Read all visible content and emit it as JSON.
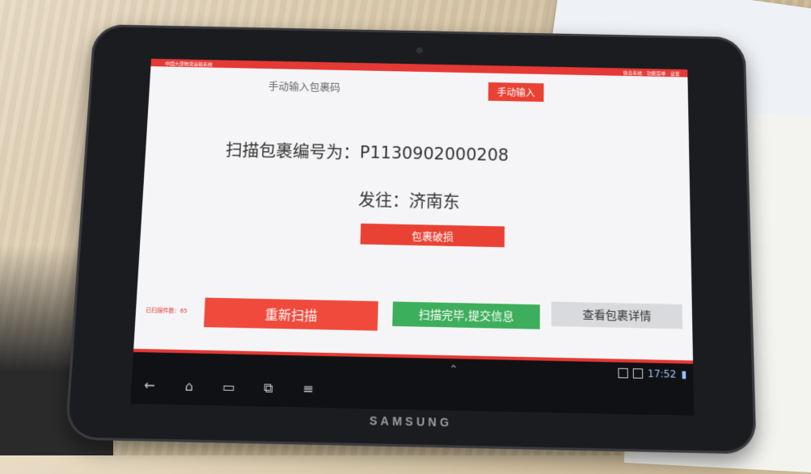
{
  "app_header": {
    "title": "中国大唐物流运输系统",
    "right_text": "信息系统 · 功能菜单 · 设置"
  },
  "manual": {
    "label": "手动输入包裹码",
    "button": "手动输入"
  },
  "scan": {
    "text": "扫描包裹编号为：P1130902000208"
  },
  "destination": {
    "text": "发往：济南东"
  },
  "damage_button": "包裹破损",
  "bottom": {
    "scanned_count": "已扫描件数：65",
    "rescan": "重新扫描",
    "submit": "扫描完毕,提交信息",
    "details": "查看包裹详情"
  },
  "system": {
    "time": "17:52",
    "brand": "SAMSUNG",
    "icons": [
      "back-icon",
      "home-icon",
      "recent-apps-icon",
      "screenshot-icon",
      "menu-icon"
    ]
  }
}
